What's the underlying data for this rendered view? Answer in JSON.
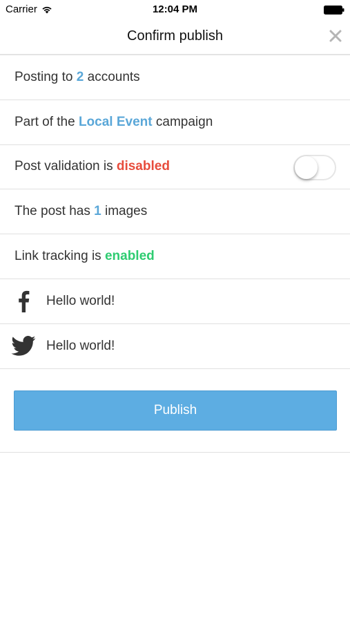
{
  "status_bar": {
    "carrier": "Carrier",
    "time": "12:04 PM"
  },
  "header": {
    "title": "Confirm publish",
    "close_icon": "close-icon"
  },
  "summary": {
    "accounts": {
      "prefix": "Posting to ",
      "value": "2",
      "suffix": " accounts"
    },
    "campaign": {
      "prefix": "Part of the ",
      "value": "Local Event",
      "suffix": " campaign"
    },
    "validation": {
      "prefix": "Post validation is ",
      "value": "disabled",
      "toggle_on": false
    },
    "images": {
      "prefix": "The post has ",
      "value": "1",
      "suffix": " images"
    },
    "tracking": {
      "prefix": "Link tracking is ",
      "value": "enabled"
    }
  },
  "posts": [
    {
      "network": "facebook",
      "icon": "facebook-icon",
      "text": "Hello world!"
    },
    {
      "network": "twitter",
      "icon": "twitter-icon",
      "text": "Hello world!"
    }
  ],
  "publish_label": "Publish",
  "colors": {
    "accent": "#5aa7d8",
    "disabled": "#e74c3c",
    "enabled": "#2ecc71",
    "button": "#5dade2"
  }
}
